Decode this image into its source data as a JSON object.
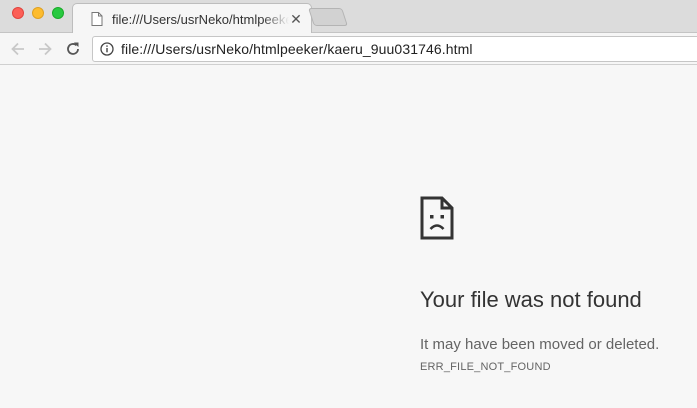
{
  "tab": {
    "title": "file:///Users/usrNeko/htmlpeeker/kaeru_9uu031746.html",
    "close_glyph": "✕",
    "favicon": "document-icon"
  },
  "toolbar": {
    "back_icon": "back-arrow-icon",
    "forward_icon": "forward-arrow-icon",
    "reload_icon": "reload-icon",
    "info_icon": "info-icon",
    "url": "file:///Users/usrNeko/htmlpeeker/kaeru_9uu031746.html"
  },
  "error": {
    "icon": "sad-file-icon",
    "heading": "Your file was not found",
    "message": "It may have been moved or deleted.",
    "code": "ERR_FILE_NOT_FOUND"
  },
  "colors": {
    "close": "#fc5f57",
    "minimize": "#fdbc2e",
    "maximize": "#28c940",
    "page_background": "#f7f7f7"
  }
}
